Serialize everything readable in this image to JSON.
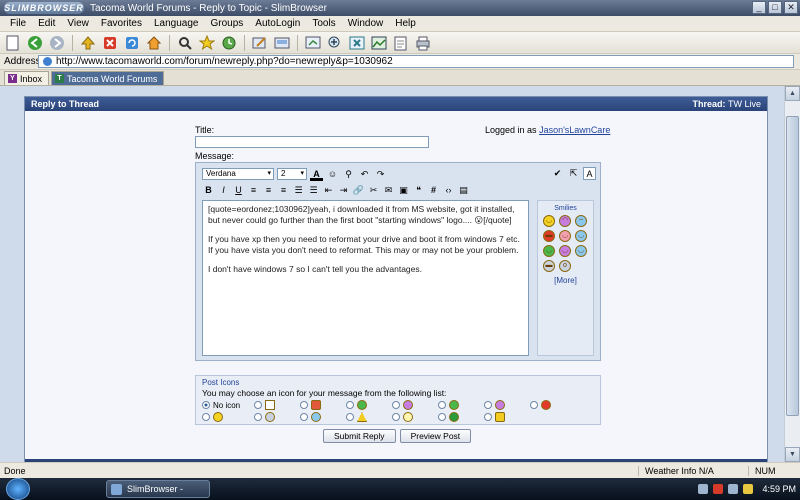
{
  "window": {
    "brand": "SLIMBROWSER",
    "title": "Tacoma World Forums - Reply to Topic - SlimBrowser",
    "controls": [
      "_",
      "□",
      "✕"
    ]
  },
  "menu": [
    "File",
    "Edit",
    "View",
    "Favorites",
    "Language",
    "Groups",
    "AutoLogin",
    "Tools",
    "Window",
    "Help"
  ],
  "toolbar": {
    "icons": [
      "new-page-icon",
      "back-icon",
      "forward-icon",
      "up-icon",
      "stop-icon",
      "refresh-icon",
      "home-icon",
      "search-icon",
      "favorites-icon",
      "history-icon",
      "edit-icon",
      "save-icon",
      "zoom-icon",
      "close-all-icon",
      "image-icon",
      "notes-icon",
      "print-icon"
    ]
  },
  "address": {
    "label": "Address",
    "url": "http://www.tacomaworld.com/forum/newreply.php?do=newreply&p=1030962"
  },
  "tabs": [
    {
      "label": "Inbox",
      "active": false,
      "icon": "Y"
    },
    {
      "label": "Tacoma World Forums",
      "active": true,
      "icon": "T"
    }
  ],
  "reply": {
    "heading": "Reply to Thread",
    "thread_prefix": "Thread:",
    "thread_name": "TW Live",
    "title_label": "Title:",
    "logged_prefix": "Logged in as",
    "username": "Jason'sLawnCare",
    "message_label": "Message:",
    "font": "Verdana",
    "size": "2",
    "message_paragraphs": [
      "[quote=eordonez;1030962]yeah, i downloaded it from MS website, got it installed, but never could go further than the first boot \"starting windows\" logo.... 😮[/quote]",
      "If you have xp then you need to reformat your drive and boot it from windows 7 etc. If you have vista you don't need to reformat. This may or may not be your problem.",
      "I don't have windows 7 so I can't tell you the advantages."
    ],
    "smilies_title": "Smilies",
    "more_link": "[More]",
    "post_icons_title": "Post Icons",
    "post_icons_desc": "You may choose an icon for your message from the following list:",
    "no_icon_label": "No icon",
    "submit_label": "Submit Reply",
    "preview_label": "Preview Post"
  },
  "status": {
    "text": "Done",
    "weather": "Weather Info N/A",
    "num": "NUM"
  },
  "taskbar": {
    "task": "SlimBrowser - Taco...",
    "time": "4:59 PM"
  }
}
